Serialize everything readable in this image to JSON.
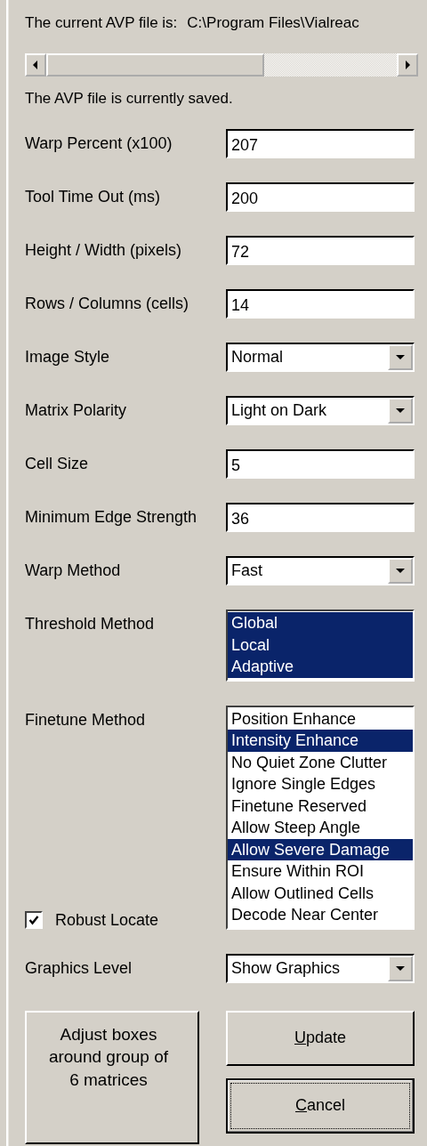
{
  "current_file": {
    "label": "The current AVP file is:",
    "path": "C:\\Program Files\\Vialreac"
  },
  "save_status": "The AVP file is currently saved.",
  "settings": [
    {
      "kind": "text",
      "label": "Warp Percent (x100)",
      "value": "207"
    },
    {
      "kind": "text",
      "label": "Tool Time Out (ms)",
      "value": "200"
    },
    {
      "kind": "text",
      "label": "Height / Width (pixels)",
      "value": "72"
    },
    {
      "kind": "text",
      "label": "Rows / Columns (cells)",
      "value": "14"
    },
    {
      "kind": "dropdown",
      "label": "Image Style",
      "value": "Normal"
    },
    {
      "kind": "dropdown",
      "label": "Matrix Polarity",
      "value": "Light on Dark"
    },
    {
      "kind": "text",
      "label": "Cell Size",
      "value": "5"
    },
    {
      "kind": "text",
      "label": "Minimum Edge Strength",
      "value": "36"
    },
    {
      "kind": "dropdown",
      "label": "Warp Method",
      "value": "Fast"
    },
    {
      "kind": "listbox",
      "label": "Threshold Method",
      "items": [
        {
          "label": "Global",
          "selected": true
        },
        {
          "label": "Local",
          "selected": true
        },
        {
          "label": "Adaptive",
          "selected": true
        }
      ]
    },
    {
      "kind": "listbox",
      "label": "Finetune Method",
      "checkbox": {
        "label": "Robust Locate",
        "checked": true
      },
      "items": [
        {
          "label": "Position Enhance",
          "selected": false
        },
        {
          "label": "Intensity Enhance",
          "selected": true
        },
        {
          "label": "No Quiet Zone Clutter",
          "selected": false
        },
        {
          "label": "Ignore Single Edges",
          "selected": false
        },
        {
          "label": "Finetune Reserved",
          "selected": false
        },
        {
          "label": "Allow Steep Angle",
          "selected": false
        },
        {
          "label": "Allow Severe Damage",
          "selected": true
        },
        {
          "label": "Ensure Within ROI",
          "selected": false
        },
        {
          "label": "Allow Outlined Cells",
          "selected": false
        },
        {
          "label": "Decode Near Center",
          "selected": false
        }
      ]
    },
    {
      "kind": "dropdown",
      "label": "Graphics Level",
      "value": "Show Graphics"
    }
  ],
  "adjust_button": "Adjust boxes around group of 6 matrices",
  "buttons": [
    {
      "label": "Update",
      "mnemonic": true,
      "focused": false
    },
    {
      "label": "Cancel",
      "mnemonic": true,
      "focused": true
    }
  ]
}
